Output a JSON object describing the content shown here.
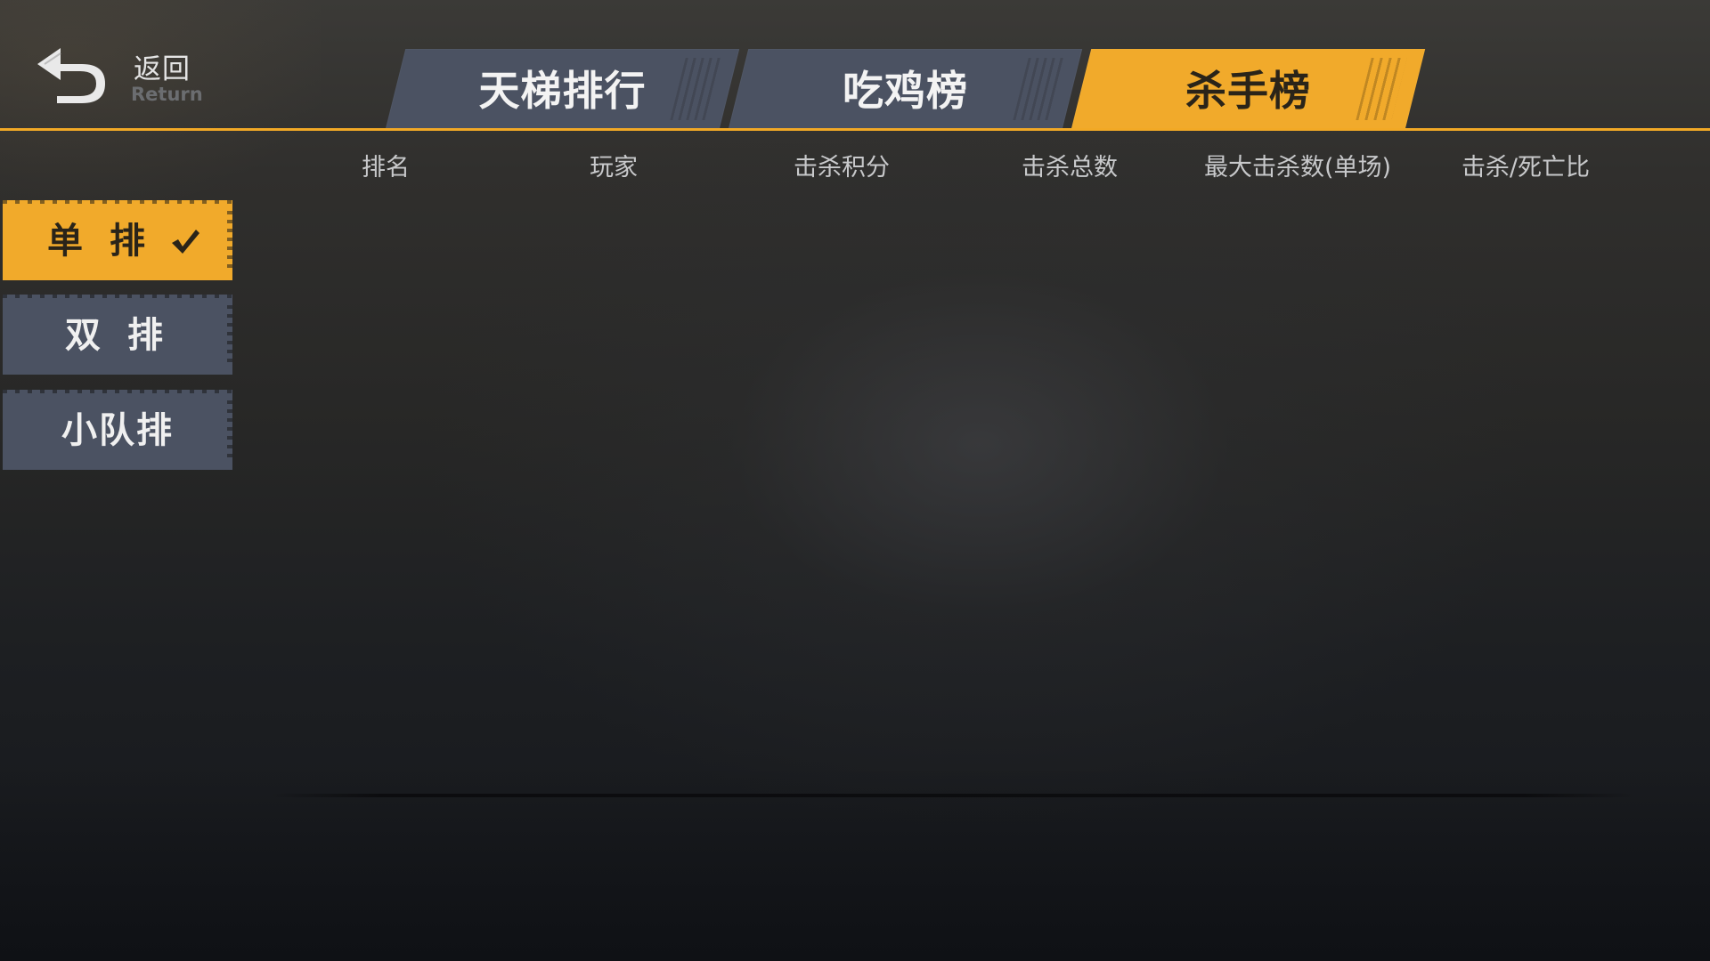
{
  "header": {
    "back_label": "返回",
    "back_sublabel": "Return",
    "tabs": [
      {
        "label": "天梯排行",
        "active": false
      },
      {
        "label": "吃鸡榜",
        "active": false
      },
      {
        "label": "杀手榜",
        "active": true
      }
    ]
  },
  "table": {
    "columns": [
      "排名",
      "玩家",
      "击杀积分",
      "击杀总数",
      "最大击杀数(单场)",
      "击杀/死亡比"
    ],
    "rows": []
  },
  "sidebar": {
    "items": [
      {
        "label": "单 排",
        "active": true,
        "icon": "check-icon"
      },
      {
        "label": "双 排",
        "active": false
      },
      {
        "label": "小队排",
        "active": false
      }
    ]
  },
  "colors": {
    "accent": "#f1aa2b",
    "tab_inactive": "#4b5262",
    "text_light": "#f0f0f0",
    "text_dark": "#2a2419"
  }
}
